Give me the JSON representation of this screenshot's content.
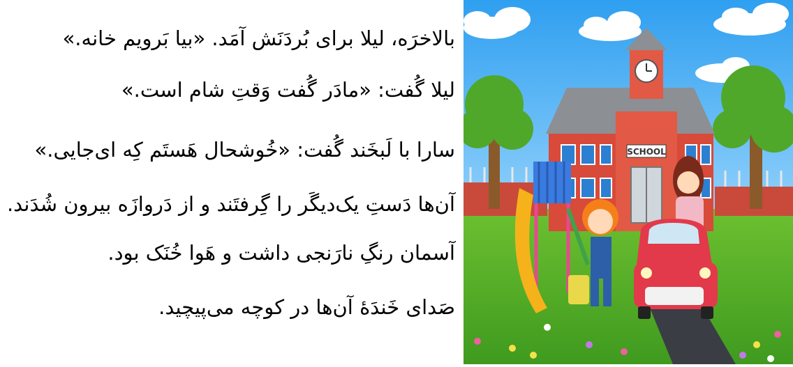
{
  "story": {
    "lines": [
      "بالاخرَه، لیلا برای بُردَنَش آمَد. «بیا بَرویم خانه.»",
      "لیلا گُفت: «مادَر گُفت وَقتِ شام است.»",
      "سارا با لَبخَند گُفت: «خُوشحال هَستَم کِه ای‌جایی.»",
      "آن‌ها دَستِ یک‌دیگَر را گِرفتَند و از دَروازَه بیرون شُدَند.",
      "آسمان رنگِ نارَنجی داشت و هَوا خُنَک بود.",
      "صَدای خَندَۀ آن‌ها در کوچه می‌پیچید."
    ]
  },
  "illustration": {
    "school_sign": "SCHOOL",
    "colors": {
      "sky": "#3fa9f5",
      "building": "#d84a3a",
      "roof": "#8c8f94",
      "grass": "#5fb52b",
      "car": "#e23a4a",
      "slide": "#f5b21a"
    }
  }
}
